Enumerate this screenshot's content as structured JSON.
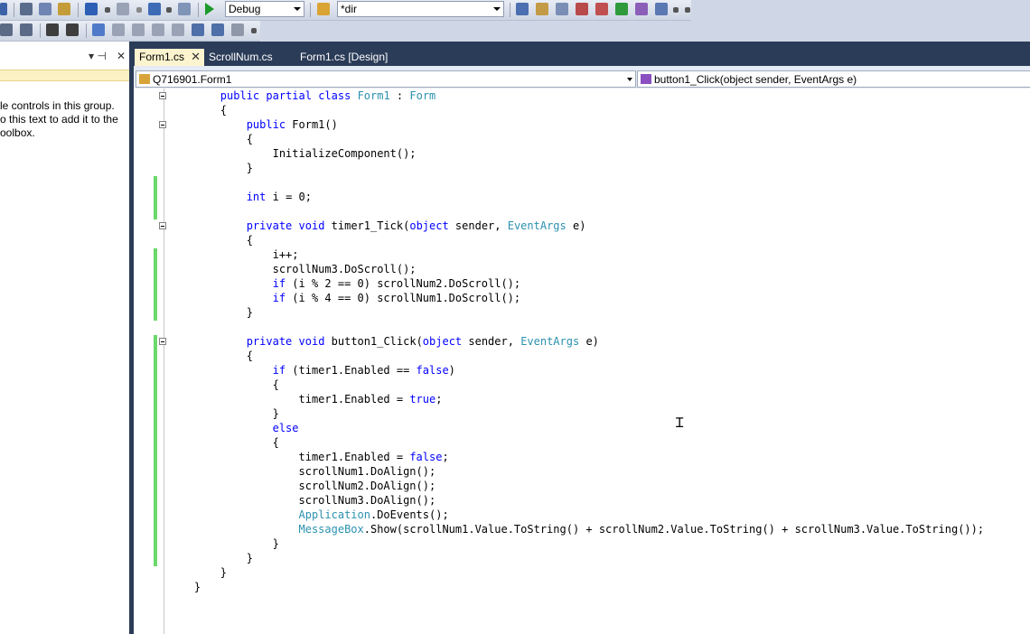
{
  "toolbar": {
    "config_value": "Debug",
    "find_value": "*dir"
  },
  "toolbox": {
    "message_lines": [
      "le controls in this group.",
      "o this text to add it to the",
      "oolbox."
    ],
    "pin_glyph": "▾ ⊣",
    "close_glyph": "✕"
  },
  "tabs": [
    {
      "label": "Form1.cs",
      "active": true
    },
    {
      "label": "ScrollNum.cs",
      "active": false
    },
    {
      "label": "Form1.cs [Design]",
      "active": false
    }
  ],
  "nav": {
    "class_selector": "Q716901.Form1",
    "member_selector": "button1_Click(object sender, EventArgs e)"
  },
  "code_lines": [
    [
      {
        "t": "        "
      },
      {
        "t": "public",
        "c": "kw"
      },
      {
        "t": " "
      },
      {
        "t": "partial",
        "c": "kw"
      },
      {
        "t": " "
      },
      {
        "t": "class",
        "c": "kw"
      },
      {
        "t": " "
      },
      {
        "t": "Form1",
        "c": "ty"
      },
      {
        "t": " : "
      },
      {
        "t": "Form",
        "c": "ty"
      }
    ],
    [
      {
        "t": "        {"
      }
    ],
    [
      {
        "t": "            "
      },
      {
        "t": "public",
        "c": "kw"
      },
      {
        "t": " Form1()"
      }
    ],
    [
      {
        "t": "            {"
      }
    ],
    [
      {
        "t": "                InitializeComponent();"
      }
    ],
    [
      {
        "t": "            }"
      }
    ],
    [
      {
        "t": ""
      }
    ],
    [
      {
        "t": "            "
      },
      {
        "t": "int",
        "c": "kw"
      },
      {
        "t": " i = 0;"
      }
    ],
    [
      {
        "t": ""
      }
    ],
    [
      {
        "t": "            "
      },
      {
        "t": "private",
        "c": "kw"
      },
      {
        "t": " "
      },
      {
        "t": "void",
        "c": "kw"
      },
      {
        "t": " timer1_Tick("
      },
      {
        "t": "object",
        "c": "kw"
      },
      {
        "t": " sender, "
      },
      {
        "t": "EventArgs",
        "c": "ty"
      },
      {
        "t": " e)"
      }
    ],
    [
      {
        "t": "            {"
      }
    ],
    [
      {
        "t": "                i++;"
      }
    ],
    [
      {
        "t": "                scrollNum3.DoScroll();"
      }
    ],
    [
      {
        "t": "                "
      },
      {
        "t": "if",
        "c": "kw"
      },
      {
        "t": " (i % 2 == 0) scrollNum2.DoScroll();"
      }
    ],
    [
      {
        "t": "                "
      },
      {
        "t": "if",
        "c": "kw"
      },
      {
        "t": " (i % 4 == 0) scrollNum1.DoScroll();"
      }
    ],
    [
      {
        "t": "            }"
      }
    ],
    [
      {
        "t": ""
      }
    ],
    [
      {
        "t": "            "
      },
      {
        "t": "private",
        "c": "kw"
      },
      {
        "t": " "
      },
      {
        "t": "void",
        "c": "kw"
      },
      {
        "t": " button1_Click("
      },
      {
        "t": "object",
        "c": "kw"
      },
      {
        "t": " sender, "
      },
      {
        "t": "EventArgs",
        "c": "ty"
      },
      {
        "t": " e)"
      }
    ],
    [
      {
        "t": "            {"
      }
    ],
    [
      {
        "t": "                "
      },
      {
        "t": "if",
        "c": "kw"
      },
      {
        "t": " (timer1.Enabled == "
      },
      {
        "t": "false",
        "c": "kw"
      },
      {
        "t": ")"
      }
    ],
    [
      {
        "t": "                {"
      }
    ],
    [
      {
        "t": "                    timer1.Enabled = "
      },
      {
        "t": "true",
        "c": "kw"
      },
      {
        "t": ";"
      }
    ],
    [
      {
        "t": "                }"
      }
    ],
    [
      {
        "t": "                "
      },
      {
        "t": "else",
        "c": "kw"
      }
    ],
    [
      {
        "t": "                {"
      }
    ],
    [
      {
        "t": "                    timer1.Enabled = "
      },
      {
        "t": "false",
        "c": "kw"
      },
      {
        "t": ";"
      }
    ],
    [
      {
        "t": "                    scrollNum1.DoAlign();"
      }
    ],
    [
      {
        "t": "                    scrollNum2.DoAlign();"
      }
    ],
    [
      {
        "t": "                    scrollNum3.DoAlign();"
      }
    ],
    [
      {
        "t": "                    "
      },
      {
        "t": "Application",
        "c": "ty"
      },
      {
        "t": ".DoEvents();"
      }
    ],
    [
      {
        "t": "                    "
      },
      {
        "t": "MessageBox",
        "c": "ty"
      },
      {
        "t": ".Show(scrollNum1.Value.ToString() + scrollNum2.Value.ToString() + scrollNum3.Value.ToString());"
      }
    ],
    [
      {
        "t": "                }"
      }
    ],
    [
      {
        "t": "            }"
      }
    ],
    [
      {
        "t": "        }"
      }
    ],
    [
      {
        "t": "    }"
      }
    ]
  ],
  "colors": {
    "keyword": "#0000ff",
    "type": "#2b91af",
    "changed_line": "#6ad96a",
    "tab_strip": "#2b3c58",
    "active_tab": "#fcf4cf"
  }
}
